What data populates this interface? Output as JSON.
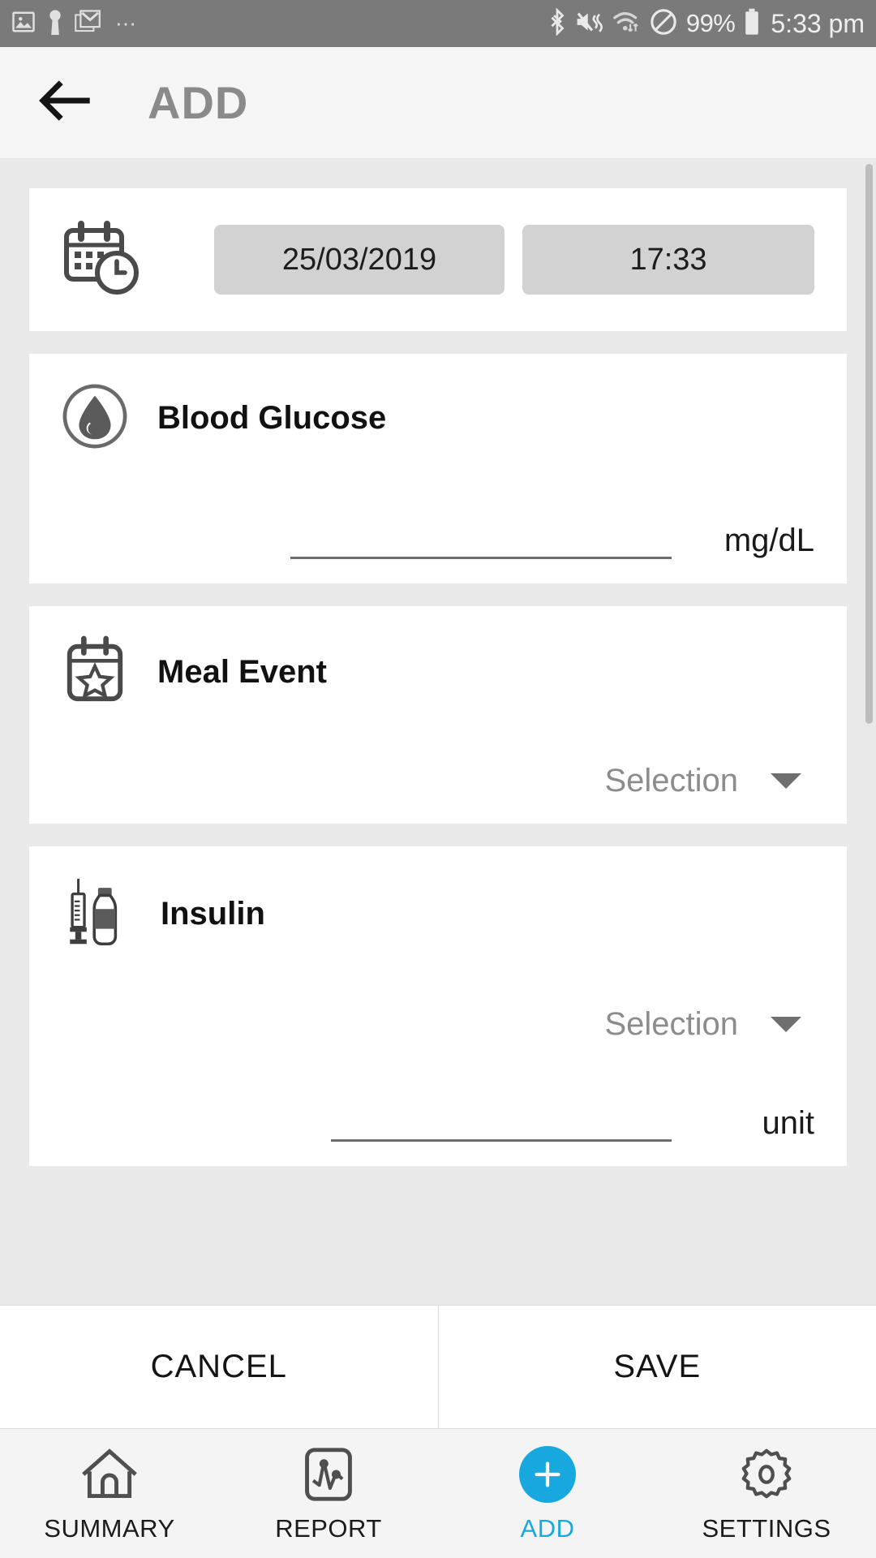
{
  "status_bar": {
    "left_icons": [
      "image-icon",
      "keyhole-icon",
      "gmail-icon",
      "more-dots-icon"
    ],
    "right_icons": [
      "bluetooth-icon",
      "vibrate-mute-icon",
      "wifi-icon",
      "do-not-disturb-icon",
      "battery-icon"
    ],
    "battery_percent": "99%",
    "clock": "5:33 pm"
  },
  "appbar": {
    "back_icon": "back-arrow-icon",
    "title": "ADD"
  },
  "datetime": {
    "icon": "calendar-clock-icon",
    "date": "25/03/2019",
    "time": "17:33"
  },
  "blood_glucose": {
    "icon": "blood-drop-icon",
    "title": "Blood Glucose",
    "value": "",
    "placeholder": "",
    "unit": "mg/dL"
  },
  "meal_event": {
    "icon": "calendar-star-icon",
    "title": "Meal Event",
    "selection": "Selection",
    "caret": "chevron-down-icon"
  },
  "insulin": {
    "icon": "syringe-vial-icon",
    "title": "Insulin",
    "selection": "Selection",
    "caret": "chevron-down-icon",
    "value": "",
    "placeholder": "",
    "unit": "unit"
  },
  "actions": {
    "cancel_label": "CANCEL",
    "save_label": "SAVE"
  },
  "bottom_nav": {
    "items": [
      {
        "label": "SUMMARY",
        "icon": "home-icon",
        "active": false
      },
      {
        "label": "REPORT",
        "icon": "chart-phone-icon",
        "active": false
      },
      {
        "label": "ADD",
        "icon": "plus-circle-icon",
        "active": true
      },
      {
        "label": "SETTINGS",
        "icon": "gear-icon",
        "active": false
      }
    ]
  },
  "colors": {
    "accent": "#18a8e0",
    "statusbar": "#7a7a7a",
    "appbar_title": "#8a8a8a",
    "page_bg": "#e9e9e9"
  }
}
